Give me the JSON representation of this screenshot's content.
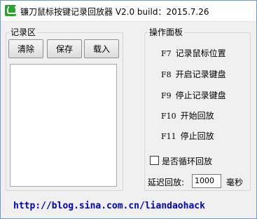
{
  "window": {
    "title": "镰刀鼠标按键记录回放器 V2.0 build：2015.7.26"
  },
  "record": {
    "legend": "记录区",
    "clear_label": "清除",
    "save_label": "保存",
    "load_label": "载入"
  },
  "panel": {
    "legend": "操作面板",
    "hotkeys": [
      {
        "key": "F7",
        "action": "记录鼠标位置"
      },
      {
        "key": "F8",
        "action": "开启记录键盘"
      },
      {
        "key": "F9",
        "action": "停止记录键盘"
      },
      {
        "key": "F10",
        "action": "开始回放"
      },
      {
        "key": "F11",
        "action": "停止回放"
      }
    ],
    "loop_label": "是否循环回放",
    "delay_label": "延迟回放:",
    "delay_value": "1000",
    "delay_unit": "毫秒"
  },
  "footer": {
    "link": "http://blog.sina.com.cn/liandaohack"
  },
  "colors": {
    "link": "#0000cc",
    "icon": "#2aa52a"
  }
}
